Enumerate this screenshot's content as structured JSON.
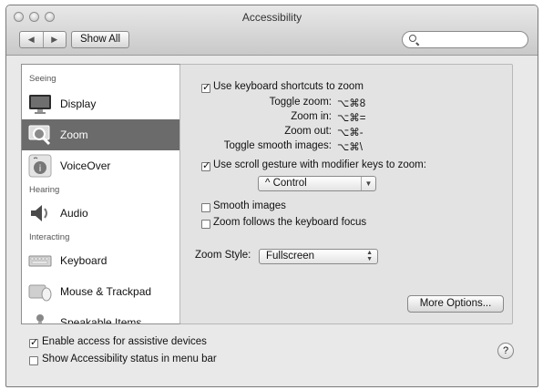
{
  "window": {
    "title": "Accessibility"
  },
  "toolbar": {
    "back": "◀",
    "forward": "▶",
    "show_all": "Show All",
    "search_placeholder": ""
  },
  "sidebar": {
    "sections": [
      "Seeing",
      "Hearing",
      "Interacting"
    ],
    "items": [
      {
        "label": "Display",
        "icon": "display-icon",
        "selected": false
      },
      {
        "label": "Zoom",
        "icon": "zoom-icon",
        "selected": true
      },
      {
        "label": "VoiceOver",
        "icon": "voiceover-icon",
        "selected": false
      },
      {
        "label": "Audio",
        "icon": "audio-icon",
        "selected": false
      },
      {
        "label": "Keyboard",
        "icon": "keyboard-icon",
        "selected": false
      },
      {
        "label": "Mouse & Trackpad",
        "icon": "mouse-trackpad-icon",
        "selected": false
      },
      {
        "label": "Speakable Items",
        "icon": "speakable-items-icon",
        "selected": false
      }
    ]
  },
  "zoom": {
    "keyboard_shortcuts": {
      "label": "Use keyboard shortcuts to zoom",
      "checked": true
    },
    "shortcuts": [
      {
        "name": "Toggle zoom:",
        "keys": "⌥⌘8"
      },
      {
        "name": "Zoom in:",
        "keys": "⌥⌘="
      },
      {
        "name": "Zoom out:",
        "keys": "⌥⌘-"
      },
      {
        "name": "Toggle smooth images:",
        "keys": "⌥⌘\\"
      }
    ],
    "scroll_gesture": {
      "label": "Use scroll gesture with modifier keys to zoom:",
      "checked": true
    },
    "modifier_value": "^ Control",
    "smooth_images": {
      "label": "Smooth images",
      "checked": false
    },
    "follow_focus": {
      "label": "Zoom follows the keyboard focus",
      "checked": false
    },
    "style_label": "Zoom Style:",
    "style_value": "Fullscreen",
    "more_options": "More Options..."
  },
  "footer": {
    "assistive": {
      "label": "Enable access for assistive devices",
      "checked": true
    },
    "status_menu": {
      "label": "Show Accessibility status in menu bar",
      "checked": false
    },
    "help": "?"
  },
  "colors": {
    "selection": "#6b6b6b",
    "window_bg": "#e9e9e9"
  }
}
